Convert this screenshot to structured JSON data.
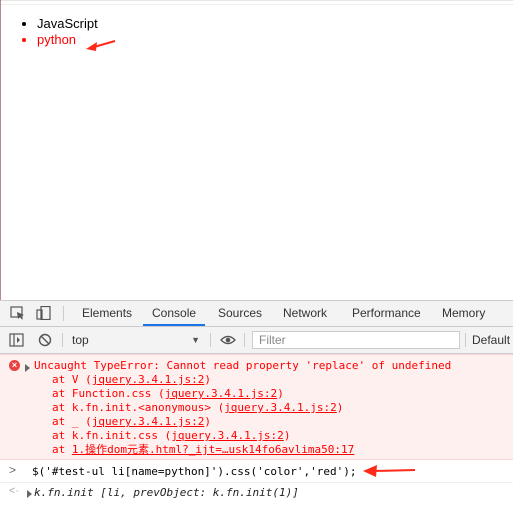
{
  "page": {
    "items": [
      {
        "label": "JavaScript"
      },
      {
        "label": "python"
      }
    ]
  },
  "devtools": {
    "tabs": [
      "Elements",
      "Console",
      "Sources",
      "Network",
      "Performance",
      "Memory"
    ],
    "active_tab": "Console",
    "toolbar": {
      "context": "top",
      "filter_placeholder": "Filter",
      "levels_label": "Default"
    },
    "console": {
      "error": {
        "message": "Uncaught TypeError: Cannot read property 'replace' of undefined",
        "stack": [
          {
            "prefix": "at V (",
            "link": "jquery.3.4.1.js:2",
            "suffix": ")"
          },
          {
            "prefix": "at Function.css (",
            "link": "jquery.3.4.1.js:2",
            "suffix": ")"
          },
          {
            "prefix": "at k.fn.init.<anonymous> (",
            "link": "jquery.3.4.1.js:2",
            "suffix": ")"
          },
          {
            "prefix": "at _ (",
            "link": "jquery.3.4.1.js:2",
            "suffix": ")"
          },
          {
            "prefix": "at k.fn.init.css (",
            "link": "jquery.3.4.1.js:2",
            "suffix": ")"
          },
          {
            "prefix": "at ",
            "link": "1.操作dom元素.html?_ijt=…usk14fo6avlima50:17",
            "suffix": ""
          }
        ]
      },
      "command": "$('#test-ul li[name=python]').css('color','red');",
      "result": "k.fn.init [li, prevObject: k.fn.init(1)]"
    }
  },
  "colors": {
    "highlight_text": "#ff0000",
    "annotation_arrow": "#ff2a1a",
    "error_bg": "#fff0f0",
    "active_tab_underline": "#1a73e8"
  },
  "icons": [
    "inspect-element-icon",
    "device-toolbar-icon",
    "sidebar-toggle-icon",
    "clear-console-icon",
    "eye-icon",
    "error-icon",
    "expand-triangle-icon",
    "prompt-chevron-icon",
    "result-arrow-icon",
    "annotation-arrow-icon"
  ]
}
